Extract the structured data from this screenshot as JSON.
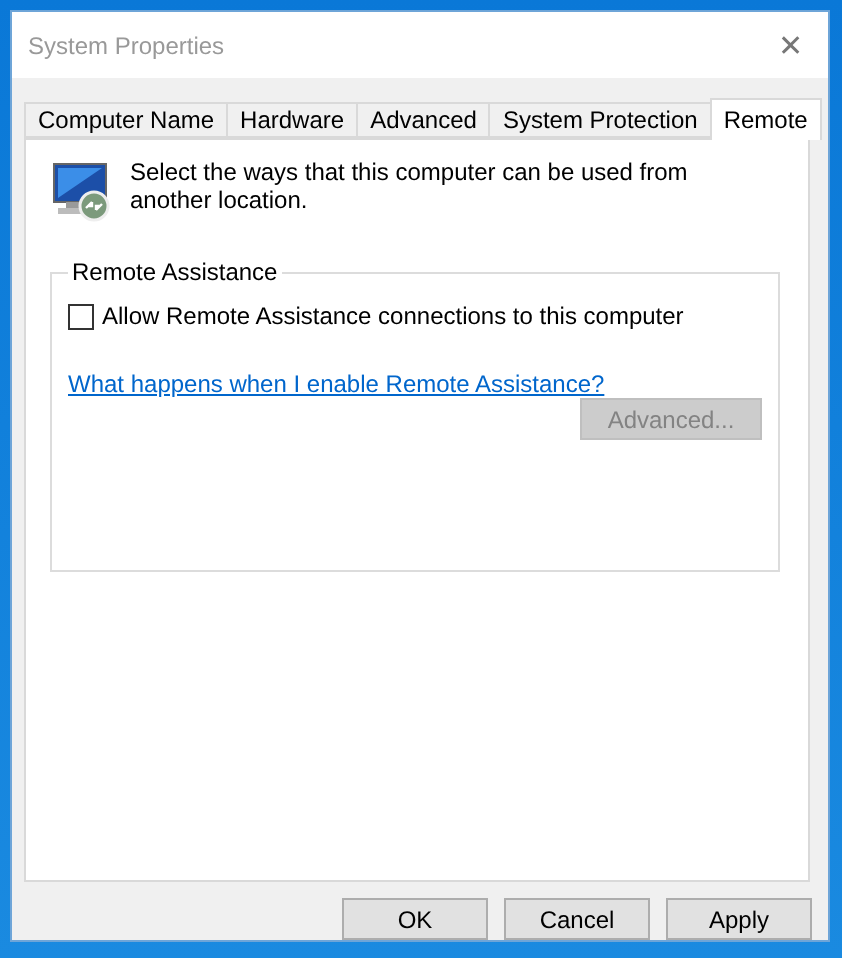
{
  "window": {
    "title": "System Properties",
    "close": "✕"
  },
  "tabs": [
    {
      "label": "Computer Name",
      "selected": false
    },
    {
      "label": "Hardware",
      "selected": false
    },
    {
      "label": "Advanced",
      "selected": false
    },
    {
      "label": "System Protection",
      "selected": false
    },
    {
      "label": "Remote",
      "selected": true
    }
  ],
  "intro": "Select the ways that this computer can be used from another location.",
  "remote_assistance": {
    "title": "Remote Assistance",
    "checkbox": {
      "label": "Allow Remote Assistance connections to this computer",
      "checked": false
    },
    "link": "What happens when I enable Remote Assistance?",
    "advanced_button": {
      "label": "Advanced...",
      "disabled": true
    }
  },
  "buttons": [
    "OK",
    "Cancel",
    "Apply"
  ]
}
